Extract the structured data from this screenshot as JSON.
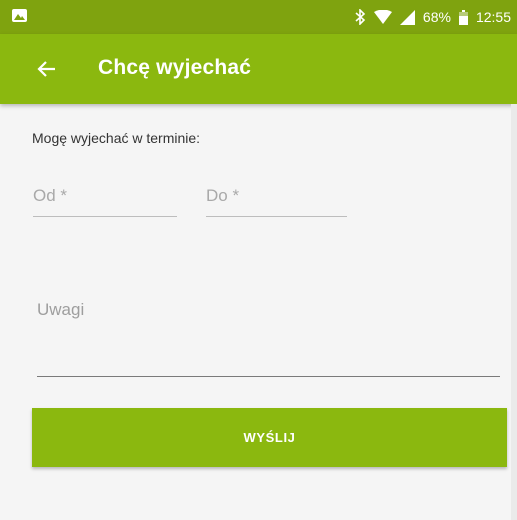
{
  "status_bar": {
    "battery_percent": "68%",
    "time": "12:55",
    "icons": [
      "image-notification-icon",
      "bluetooth-icon",
      "wifi-icon",
      "signal-icon",
      "battery-icon"
    ]
  },
  "app_bar": {
    "title": "Chcę wyjechać",
    "back_icon": "arrow-back-icon"
  },
  "form": {
    "date_range_label": "Mogę wyjechać w terminie:",
    "from_placeholder": "Od *",
    "to_placeholder": "Do *",
    "notes_placeholder": "Uwagi",
    "submit_label": "WYŚLIJ"
  },
  "colors": {
    "status_bar": "#7fa30f",
    "primary": "#8bb80f",
    "background": "#f5f5f5"
  }
}
